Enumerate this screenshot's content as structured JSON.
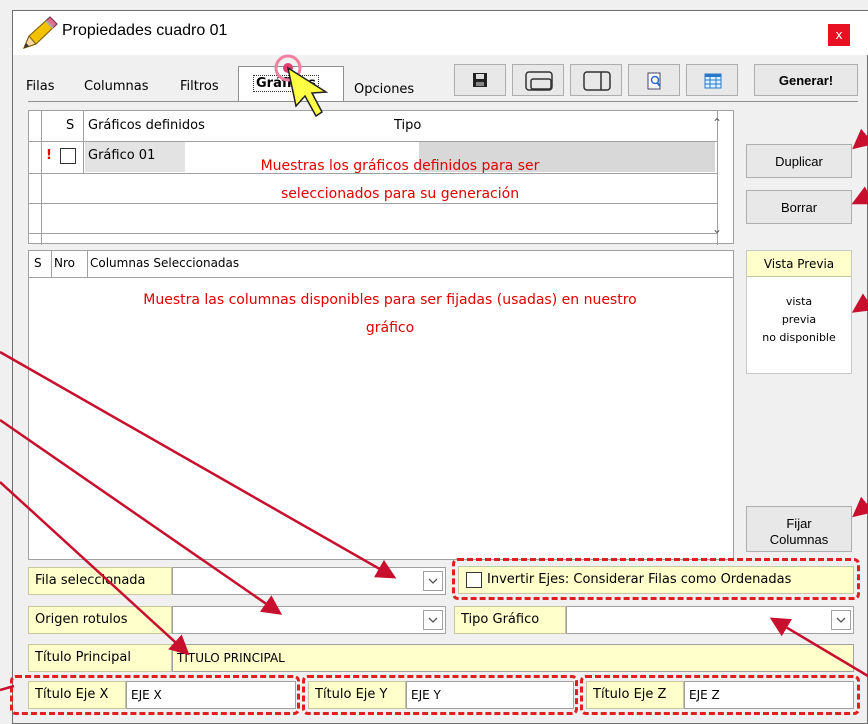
{
  "window": {
    "title": "Propiedades cuadro 01",
    "close_label": "x"
  },
  "tabs": [
    "Filas",
    "Columnas",
    "Filtros",
    "Gráficos",
    "Opciones"
  ],
  "toolbar": {
    "generate_label": "Generar!"
  },
  "charts_grid": {
    "col_s": "S",
    "col_defined": "Gráficos definidos",
    "col_type": "Tipo",
    "rows": [
      {
        "flag": "!",
        "name": "Gráfico 01",
        "type": ""
      }
    ]
  },
  "annotations": {
    "charts_note_line1": "Muestras los gráficos definidos para ser",
    "charts_note_line2": "seleccionados para su generación",
    "columns_note_line1": "Muestra las columnas disponibles para ser fijadas (usadas) en nuestro",
    "columns_note_line2": "gráfico"
  },
  "buttons": {
    "duplicate": "Duplicar",
    "delete": "Borrar",
    "fix_columns_line1": "Fijar",
    "fix_columns_line2": "Columnas"
  },
  "columns_grid": {
    "col_s": "S",
    "col_nro": "Nro",
    "col_selected": "Columnas Seleccionadas"
  },
  "preview": {
    "header": "Vista Previa",
    "line1": "vista",
    "line2": "previa",
    "line3": "no disponible"
  },
  "form": {
    "selected_row_label": "Fila seleccionada",
    "invert_axes_label": "Invertir Ejes: Considerar Filas como Ordenadas",
    "labels_origin_label": "Origen rotulos",
    "chart_type_label": "Tipo Gráfico",
    "main_title_label": "Título Principal",
    "main_title_value": "TITULO PRINCIPAL",
    "axis_x_label": "Título Eje X",
    "axis_x_value": "EJE X",
    "axis_y_label": "Título Eje Y",
    "axis_y_value": "EJE Y",
    "axis_z_label": "Título Eje Z",
    "axis_z_value": "EJE Z"
  },
  "colors": {
    "annotation_red": "#e00000",
    "label_yellow": "#ffffcc",
    "arrow_yellow": "#ffff44"
  }
}
